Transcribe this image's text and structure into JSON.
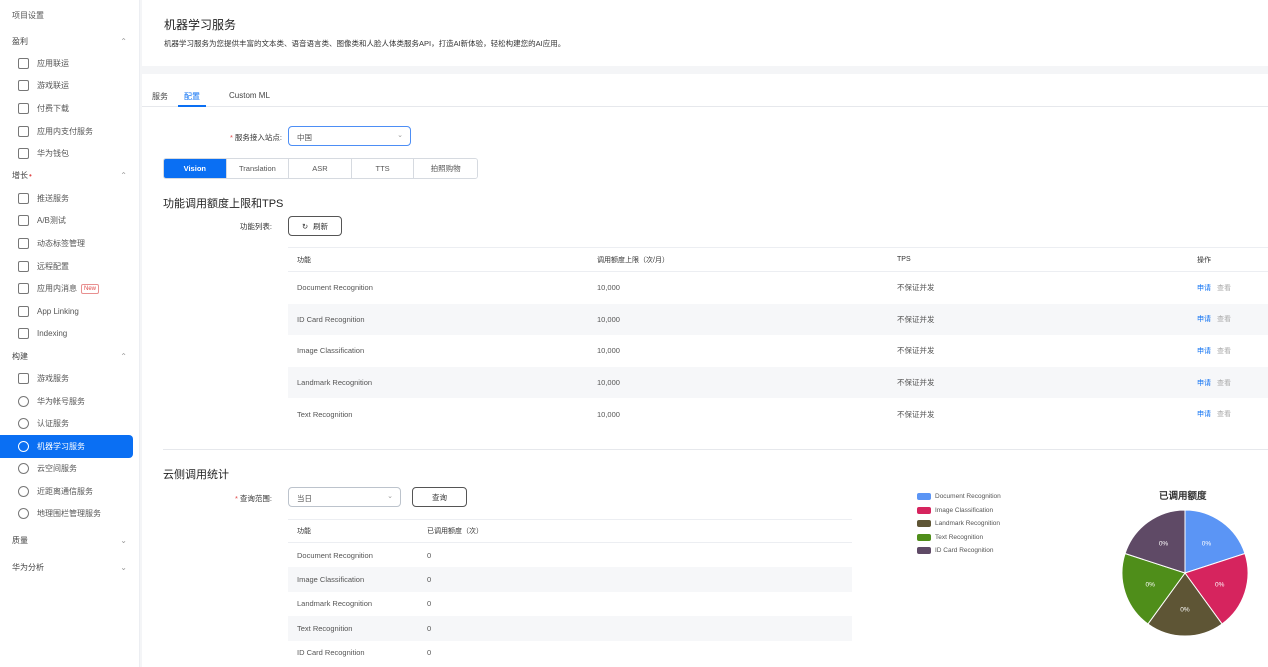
{
  "sidebar": {
    "top_label": "项目设置",
    "groups": [
      {
        "title": "盈利",
        "items": [
          "应用联运",
          "游戏联运",
          "付费下载",
          "应用内支付服务",
          "华为钱包"
        ]
      },
      {
        "title": "增长",
        "items": [
          "推送服务",
          "A/B测试",
          "动态标签管理",
          "远程配置",
          "应用内消息",
          "App Linking",
          "Indexing"
        ]
      },
      {
        "title": "构建",
        "items": [
          "游戏服务",
          "华为帐号服务",
          "认证服务",
          "机器学习服务",
          "云空间服务",
          "近距离通信服务",
          "地理围栏管理服务"
        ]
      },
      {
        "title": "质量",
        "items": []
      },
      {
        "title": "华为分析",
        "items": []
      }
    ],
    "new_badge": "New",
    "active_item": "机器学习服务"
  },
  "header": {
    "title": "机器学习服务",
    "description": "机器学习服务为您提供丰富的文本类、语音语言类、图像类和人脸人体类服务API，打造AI新体验，轻松构建您的AI应用。"
  },
  "tabs": [
    "服务",
    "配置",
    "Custom ML"
  ],
  "active_tab": "配置",
  "site": {
    "label": "服务接入站点:",
    "value": "中国"
  },
  "segments": [
    "Vision",
    "Translation",
    "ASR",
    "TTS",
    "拍照购物"
  ],
  "active_segment": "Vision",
  "quota": {
    "title": "功能调用额度上限和TPS",
    "list_label": "功能列表:",
    "refresh_label": "刷新",
    "columns": [
      "功能",
      "调用额度上限（次/月）",
      "TPS",
      "操作"
    ],
    "rows": [
      {
        "name": "Document Recognition",
        "limit": "10,000",
        "tps": "不保证并发",
        "apply": "申请",
        "view": "查看"
      },
      {
        "name": "ID Card Recognition",
        "limit": "10,000",
        "tps": "不保证并发",
        "apply": "申请",
        "view": "查看"
      },
      {
        "name": "Image Classification",
        "limit": "10,000",
        "tps": "不保证并发",
        "apply": "申请",
        "view": "查看"
      },
      {
        "name": "Landmark Recognition",
        "limit": "10,000",
        "tps": "不保证并发",
        "apply": "申请",
        "view": "查看"
      },
      {
        "name": "Text Recognition",
        "limit": "10,000",
        "tps": "不保证并发",
        "apply": "申请",
        "view": "查看"
      }
    ]
  },
  "stats": {
    "title": "云侧调用统计",
    "range_label": "查询范围:",
    "range_value": "当日",
    "query_label": "查询",
    "columns": [
      "功能",
      "已调用额度（次）"
    ],
    "rows": [
      {
        "name": "Document Recognition",
        "count": "0"
      },
      {
        "name": "Image Classification",
        "count": "0"
      },
      {
        "name": "Landmark Recognition",
        "count": "0"
      },
      {
        "name": "Text Recognition",
        "count": "0"
      },
      {
        "name": "ID Card Recognition",
        "count": "0"
      }
    ]
  },
  "chart_data": {
    "type": "pie",
    "title": "已调用额度",
    "categories": [
      "Document Recognition",
      "Image Classification",
      "Landmark Recognition",
      "Text Recognition",
      "ID Card Recognition"
    ],
    "values": [
      0,
      0,
      0,
      0,
      0
    ],
    "labels": [
      "0%",
      "0%",
      "0%",
      "0%",
      "0%"
    ],
    "colors": [
      "#5b95f5",
      "#d6245e",
      "#5e5535",
      "#4f8e1a",
      "#5f4a66"
    ],
    "legend_position": "left"
  }
}
